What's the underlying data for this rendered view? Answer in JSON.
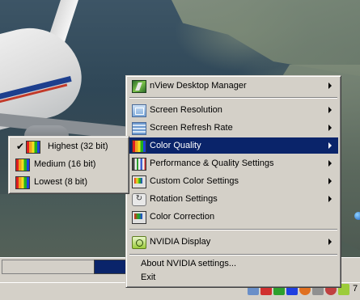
{
  "main_menu": {
    "items": [
      {
        "label": "nView Desktop Manager",
        "icon": "nview-icon",
        "submenu": true
      },
      {
        "label": "Screen Resolution",
        "icon": "screen-resolution-icon",
        "submenu": true
      },
      {
        "label": "Screen Refresh Rate",
        "icon": "refresh-rate-icon",
        "submenu": true
      },
      {
        "label": "Color Quality",
        "icon": "color-quality-icon",
        "submenu": true,
        "highlighted": true
      },
      {
        "label": "Performance & Quality Settings",
        "icon": "performance-icon",
        "submenu": true
      },
      {
        "label": "Custom Color Settings",
        "icon": "custom-color-icon",
        "submenu": true
      },
      {
        "label": "Rotation Settings",
        "icon": "rotation-icon",
        "submenu": true
      },
      {
        "label": "Color Correction",
        "icon": "color-correction-icon",
        "submenu": false
      },
      {
        "label": "NVIDIA Display",
        "icon": "nvidia-display-icon",
        "submenu": true
      },
      {
        "label": "About NVIDIA settings...",
        "icon": "",
        "submenu": false
      },
      {
        "label": "Exit",
        "icon": "",
        "submenu": false
      }
    ]
  },
  "color_submenu": {
    "items": [
      {
        "label": "Highest (32 bit)",
        "checked": true
      },
      {
        "label": "Medium (16 bit)",
        "checked": false
      },
      {
        "label": "Lowest (8 bit)",
        "checked": false
      }
    ]
  },
  "taskbar": {
    "clock_fragment": "7"
  },
  "colors": {
    "menu_bg": "#d4d0c8",
    "highlight": "#0a246a"
  }
}
